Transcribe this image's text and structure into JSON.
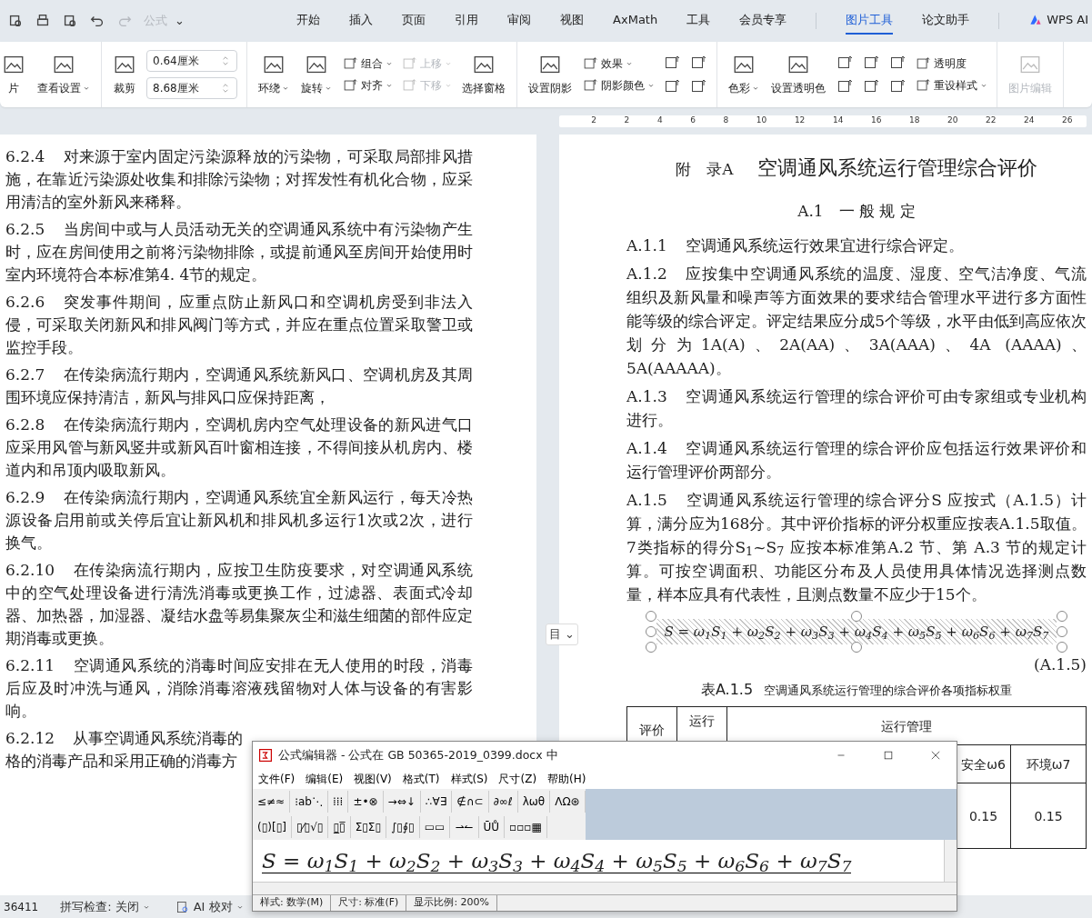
{
  "quick_access": {
    "items": [
      {
        "kind": "icon",
        "disabled": false
      },
      {
        "kind": "icon",
        "disabled": false
      },
      {
        "kind": "icon",
        "disabled": false
      },
      {
        "kind": "undo",
        "disabled": false
      },
      {
        "kind": "redo",
        "disabled": true
      }
    ],
    "formula_label": "公式",
    "more": "⌄"
  },
  "menu_tabs": [
    {
      "label": "开始",
      "selected": false
    },
    {
      "label": "插入",
      "selected": false
    },
    {
      "label": "页面",
      "selected": false
    },
    {
      "label": "引用",
      "selected": false
    },
    {
      "label": "审阅",
      "selected": false
    },
    {
      "label": "视图",
      "selected": false
    },
    {
      "label": "AxMath",
      "selected": false
    },
    {
      "label": "工具",
      "selected": false
    },
    {
      "label": "会员专享",
      "selected": false
    },
    {
      "label": "图片工具",
      "selected": true
    },
    {
      "label": "论文助手",
      "selected": false
    }
  ],
  "ai_tab": {
    "label": "WPS AI"
  },
  "ribbon": [
    {
      "columns": [
        [
          {
            "kind": "large",
            "label": "片",
            "dropdown": false,
            "disabled": false
          }
        ],
        [
          {
            "kind": "large",
            "label": "查看设置",
            "dropdown": true,
            "disabled": false
          }
        ]
      ]
    },
    {
      "columns": [
        [
          {
            "kind": "large",
            "label": "裁剪",
            "dropdown": false,
            "disabled": false
          }
        ],
        [
          {
            "kind": "field",
            "value": "0.64厘米"
          },
          {
            "kind": "field",
            "value": "8.68厘米"
          }
        ]
      ]
    },
    {
      "columns": [
        [
          {
            "kind": "large",
            "label": "环绕",
            "dropdown": true,
            "disabled": false
          }
        ],
        [
          {
            "kind": "large",
            "label": "旋转",
            "dropdown": true,
            "disabled": false
          }
        ],
        [
          {
            "kind": "small",
            "label": "组合",
            "dropdown": true,
            "disabled": false
          },
          {
            "kind": "small",
            "label": "对齐",
            "dropdown": true,
            "disabled": false
          }
        ],
        [
          {
            "kind": "small",
            "label": "上移",
            "dropdown": true,
            "disabled": true
          },
          {
            "kind": "small",
            "label": "下移",
            "dropdown": true,
            "disabled": true
          }
        ],
        [
          {
            "kind": "large",
            "label": "选择窗格",
            "dropdown": false,
            "disabled": false
          }
        ]
      ]
    },
    {
      "columns": [
        [
          {
            "kind": "large",
            "label": "设置阴影",
            "dropdown": false,
            "disabled": false
          }
        ],
        [
          {
            "kind": "small",
            "label": "效果",
            "dropdown": true,
            "disabled": false
          },
          {
            "kind": "small",
            "label": "阴影颜色",
            "dropdown": true,
            "disabled": false
          }
        ],
        [
          {
            "kind": "icon",
            "disabled": false
          },
          {
            "kind": "icon",
            "disabled": false
          }
        ],
        [
          {
            "kind": "icon",
            "disabled": false
          },
          {
            "kind": "icon",
            "disabled": false
          }
        ]
      ]
    },
    {
      "columns": [
        [
          {
            "kind": "large",
            "label": "色彩",
            "dropdown": true,
            "disabled": false
          }
        ],
        [
          {
            "kind": "large",
            "label": "设置透明色",
            "dropdown": false,
            "disabled": false
          }
        ],
        [
          {
            "kind": "icon",
            "disabled": false
          },
          {
            "kind": "icon",
            "disabled": false
          }
        ],
        [
          {
            "kind": "icon",
            "disabled": false
          },
          {
            "kind": "icon",
            "disabled": false
          }
        ],
        [
          {
            "kind": "icon",
            "disabled": false
          },
          {
            "kind": "icon",
            "disabled": false
          }
        ],
        [
          {
            "kind": "small",
            "label": "透明度",
            "dropdown": false,
            "disabled": false
          },
          {
            "kind": "small",
            "label": "重设样式",
            "dropdown": true,
            "disabled": false
          }
        ]
      ]
    },
    {
      "columns": [
        [
          {
            "kind": "large",
            "label": "图片编辑",
            "dropdown": false,
            "disabled": true
          }
        ]
      ]
    }
  ],
  "ruler": [
    "2",
    "2",
    "4",
    "6",
    "8",
    "10",
    "12",
    "14",
    "16",
    "18",
    "20",
    "22",
    "24",
    "26"
  ],
  "left_page": {
    "paragraphs": [
      {
        "num": "6.2.4",
        "text": "对来源于室内固定污染源释放的污染物，可采取局部排风措施，在靠近污染源处收集和排除污染物；对挥发性有机化合物，应采用清洁的室外新风来稀释。"
      },
      {
        "num": "6.2.5",
        "text": "当房间中或与人员活动无关的空调通风系统中有污染物产生时，应在房间使用之前将污染物排除，或提前通风至房间开始使用时室内环境符合本标准第4. 4节的规定。"
      },
      {
        "num": "6.2.6",
        "text": "突发事件期间，应重点防止新风口和空调机房受到非法入侵，可采取关闭新风和排风阀门等方式，并应在重点位置采取警卫或监控手段。"
      },
      {
        "num": "6.2.7",
        "text": "在传染病流行期内，空调通风系统新风口、空调机房及其周围环境应保持清洁，新风与排风口应保持距离，"
      },
      {
        "num": "6.2.8",
        "text": "在传染病流行期内，空调机房内空气处理设备的新风进气口应采用风管与新风竖井或新风百叶窗相连接，不得间接从机房内、楼道内和吊顶内吸取新风。"
      },
      {
        "num": "6.2.9",
        "text": "在传染病流行期内，空调通风系统宜全新风运行，每天冷热源设备启用前或关停后宜让新风机和排风机多运行1次或2次，进行换气。"
      },
      {
        "num": "6.2.10",
        "text": "在传染病流行期内，应按卫生防疫要求，对空调通风系统中的空气处理设备进行清洗消毒或更换工作，过滤器、表面式冷却器、加热器，加湿器、凝结水盘等易集聚灰尘和滋生细菌的部件应定期消毒或更换。"
      },
      {
        "num": "6.2.11",
        "text": "空调通风系统的消毒时间应安排在无人使用的时段，消毒后应及时冲洗与通风，消除消毒溶液残留物对人体与设备的有害影响。"
      }
    ],
    "cut_paragraph": {
      "num": "6.2.12",
      "lines": [
        "从事空调通风系统消毒的",
        "格的消毒产品和采用正确的消毒方"
      ]
    }
  },
  "right_page": {
    "appendix_label": "附　录A",
    "appendix_title": "空调通风系统运行管理综合评价",
    "section": "A.1　一 般 规 定",
    "paragraphs": [
      {
        "num": "A.1.1",
        "text": "空调通风系统运行效果宜进行综合评定。"
      },
      {
        "num": "A.1.2",
        "text": "应按集中空调通风系统的温度、湿度、空气洁净度、气流组织及新风量和噪声等方面效果的要求结合管理水平进行多方面性能等级的综合评定。评定结果应分成5个等级，水平由低到高应依次划分为1A(A)、2A(AA)、3A(AAA)、4A (AAAA)、5A(AAAAA)。"
      },
      {
        "num": "A.1.3",
        "text": "空调通风系统运行管理的综合评价可由专家组或专业机构进行。"
      },
      {
        "num": "A.1.4",
        "text": "空调通风系统运行管理的综合评价应包括运行效果评价和运行管理评价两部分。"
      },
      {
        "num": "A.1.5",
        "text": "空调通风系统运行管理的综合评分S 应按式（A.1.5）计算，满分应为168分。其中评价指标的评分权重应按表A.1.5取值。7类指标的得分S$_{1}$~S$_{7}$ 应按本标准第A.2 节、第 A.3 节的规定计算。可按空调面积、功能区分布及人员使用具体情况选择测点数量，样本应具有代表性，且测点数量不应少于15个。"
      }
    ],
    "formula": {
      "text": "S = ω$_{1}$S$_{1}$ + ω$_{2}$S$_{2}$ + ω$_{3}$S$_{3}$ + ω$_{4}$S$_{4}$ + ω$_{5}$S$_{5}$ + ω$_{6}$S$_{6}$ + ω$_{7}$S$_{7}$",
      "selected": true
    },
    "equation_number": "(A.1.5)",
    "table_caption": {
      "number": "表A.1.5",
      "title": "空调通风系统运行管理的综合评价各项指标权重"
    },
    "table": {
      "header": [
        "评价",
        "运行",
        "运行管理"
      ],
      "subheaders": [
        "安全ω6",
        "环境ω7"
      ],
      "values": [
        "0.15",
        "0.15"
      ]
    }
  },
  "layout_button": {
    "icon": "目",
    "caret": "⌄"
  },
  "formula_editor": {
    "title": "公式编辑器 - 公式在 GB 50365-2019_0399.docx 中",
    "menu": [
      "文件(F)",
      "编辑(E)",
      "视图(V)",
      "格式(T)",
      "样式(S)",
      "尺寸(Z)",
      "帮助(H)"
    ],
    "palette_rows": [
      [
        "≤≠≈",
        "⁝ab⋱",
        "⁞⁞⁞",
        "±•⊗",
        "→⇔↓",
        "∴∀∃",
        "∉∩⊂",
        "∂∞ℓ",
        "λωθ",
        "ΛΩ⊛"
      ],
      [
        "(▯)[▯]",
        "▯⁄▯√▯",
        "▯̲▯̅",
        "Σ▯Σ▯",
        "∫▯∮▯",
        "▭▭",
        "⇀↼",
        "ŪŮ",
        "▫▫▫▦"
      ]
    ],
    "formula": "S = ω$_{1}$S$_{1}$ + ω$_{2}$S$_{2}$ + ω$_{3}$S$_{3}$ + ω$_{4}$S$_{4}$ + ω$_{5}$S$_{5}$ + ω$_{6}$S$_{6}$ + ω$_{7}$S$_{7}$",
    "status": [
      "样式: 数学(M)",
      "尺寸: 标准(F)",
      "显示比例: 200%"
    ]
  },
  "status_bar": {
    "word_count": "36411",
    "spell_check": "拼写检查: 关闭",
    "ai_check": "AI 校对"
  }
}
